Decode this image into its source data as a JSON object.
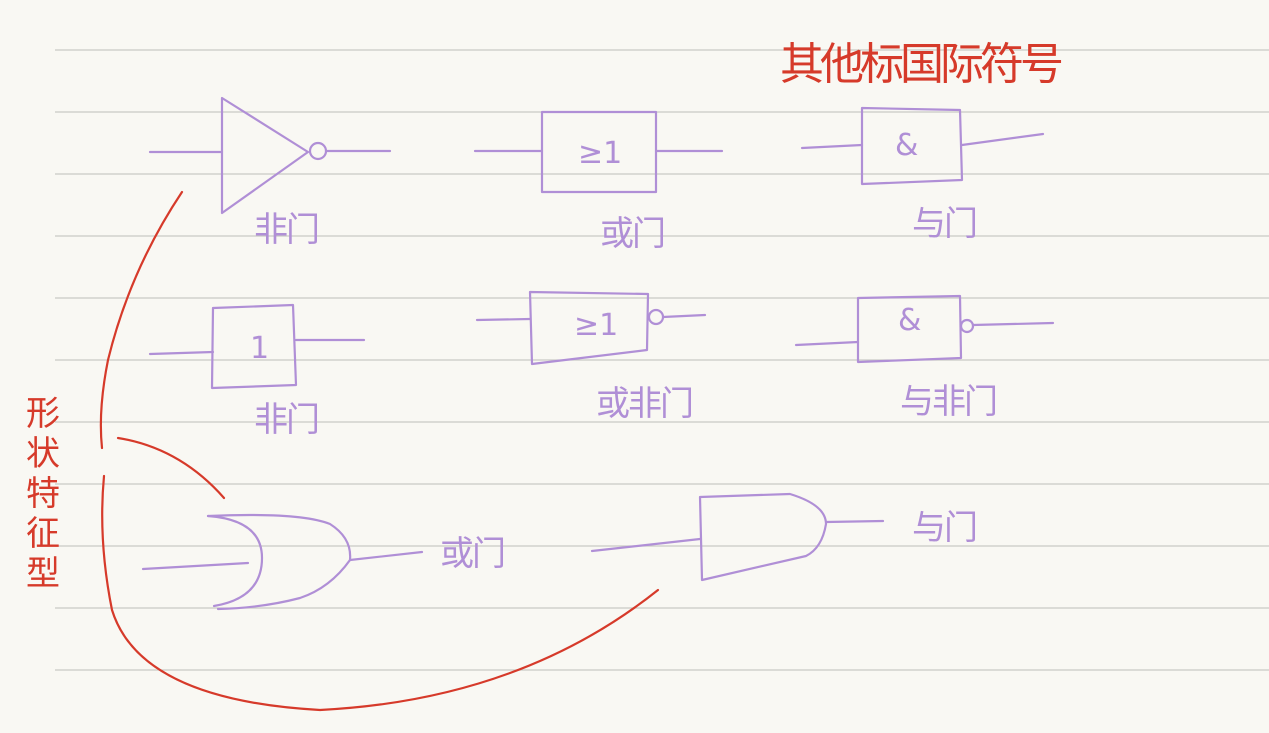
{
  "page": {
    "annotation_top": "其他标国际符号",
    "annotation_side": "形状特征型"
  },
  "labels": {
    "not_gate_top": "非门",
    "or_gate_box": "或门",
    "and_gate_box": "与门",
    "not_gate_box": "非门",
    "nor_gate_box": "或非门",
    "nand_gate_box": "与非门",
    "or_gate_shape": "或门",
    "and_gate_shape": "与门"
  },
  "symbols": {
    "or_box_text": "≥1",
    "and_box_text": "&",
    "not_box_text": "1",
    "nor_box_text": "≥1",
    "nand_box_text": "&"
  },
  "colors": {
    "paper": "#f9f8f3",
    "rules": "#c9c9c4",
    "gate_ink": "#b08fd6",
    "annotation_ink": "#d63a2a"
  }
}
